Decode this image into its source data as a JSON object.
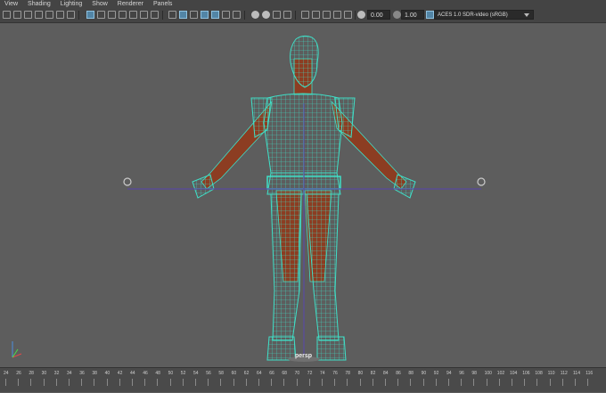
{
  "menu": {
    "items": [
      "View",
      "Shading",
      "Lighting",
      "Show",
      "Renderer",
      "Panels"
    ]
  },
  "toolbar": {
    "exposure_value": "0.00",
    "gamma_value": "1.00",
    "color_space": "ACES 1.0 SDR-video (sRGB)"
  },
  "viewport": {
    "camera_label": "persp"
  },
  "timeline": {
    "ticks": [
      "24",
      "26",
      "28",
      "30",
      "32",
      "34",
      "36",
      "38",
      "40",
      "42",
      "44",
      "46",
      "48",
      "50",
      "52",
      "54",
      "56",
      "58",
      "60",
      "62",
      "64",
      "66",
      "68",
      "70",
      "72",
      "74",
      "76",
      "78",
      "80",
      "82",
      "84",
      "86",
      "88",
      "90",
      "92",
      "94",
      "96",
      "98",
      "100",
      "102",
      "104",
      "106",
      "108",
      "110",
      "112",
      "114",
      "116"
    ]
  },
  "colors": {
    "wire": "#3fe0c8",
    "skin": "#8c3d22",
    "ui_bg": "#444444",
    "viewport_bg": "#5d5d5d",
    "selected": "#5285a6"
  }
}
